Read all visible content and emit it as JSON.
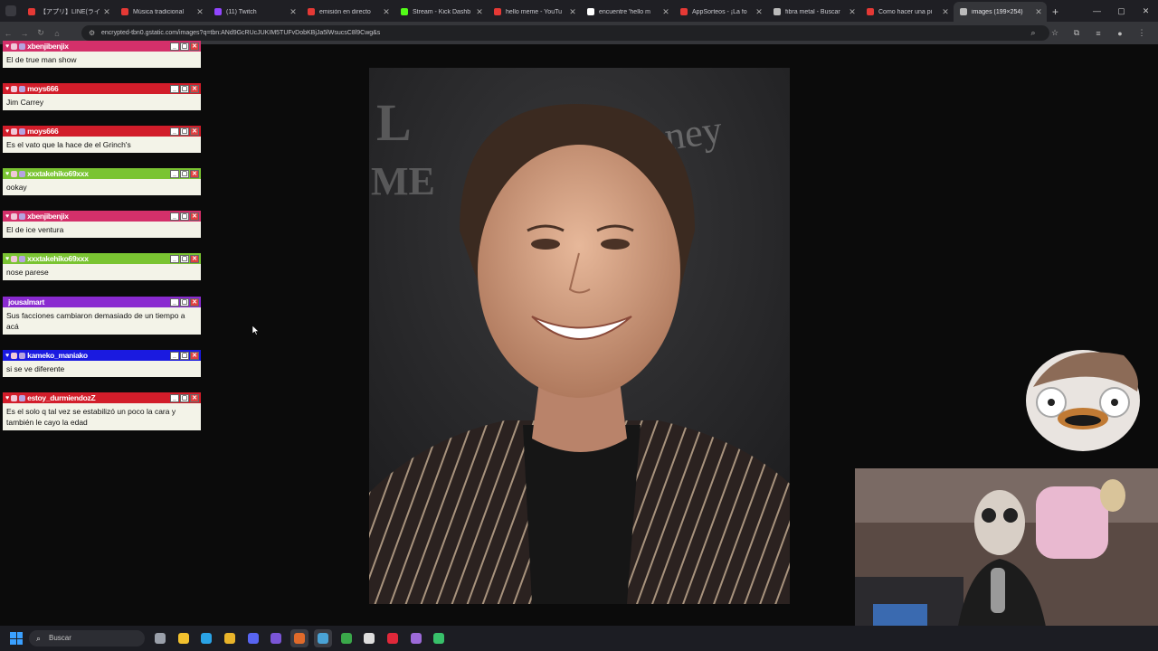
{
  "browser": {
    "tabs": [
      {
        "title": "【アプリ】LINE(ライ",
        "icon": "youtube-icon",
        "color": "#e53935"
      },
      {
        "title": "Música tradicional",
        "icon": "youtube-icon",
        "color": "#e53935"
      },
      {
        "title": "(11) Twitch",
        "icon": "twitch-icon",
        "color": "#9146ff"
      },
      {
        "title": "emisión en directo",
        "icon": "youtube-icon",
        "color": "#e53935"
      },
      {
        "title": "Stream - Kick Dashb",
        "icon": "kick-icon",
        "color": "#53fc18"
      },
      {
        "title": "hello meme - YouTu",
        "icon": "youtube-icon",
        "color": "#e53935"
      },
      {
        "title": "encuentre 'hello m",
        "icon": "tiktok-icon",
        "color": "#ffffff"
      },
      {
        "title": "AppSorteos - ¡La fo",
        "icon": "youtube-icon",
        "color": "#e53935"
      },
      {
        "title": "fibra metal - Buscar",
        "icon": "globe-icon",
        "color": "#bbbbbb"
      },
      {
        "title": "Como hacer una pi",
        "icon": "youtube-icon",
        "color": "#e53935"
      },
      {
        "title": "images (199×254)",
        "icon": "globe-icon",
        "color": "#bbbbbb",
        "active": true
      }
    ],
    "new_tab_glyph": "+",
    "window_controls": {
      "minimize": "—",
      "maximize": "▢",
      "close": "✕"
    },
    "url": "encrypted-tbn0.gstatic.com/images?q=tbn:ANd9GcRUcJUKIM5TUFvDobKBjJa5lWsucsC8l9Cwg&s",
    "nav": {
      "back": "←",
      "forward": "→",
      "reload": "↻",
      "home": "⌂"
    },
    "toolbar_icons": [
      "zoom-icon",
      "star-icon",
      "extensions-icon",
      "media-icon",
      "profile-icon",
      "menu-icon"
    ]
  },
  "chat": {
    "messages": [
      {
        "user": "xbenjibenjix",
        "text": "El de true man show",
        "header_color": "#d4306a",
        "badges": true
      },
      {
        "user": "moys666",
        "text": "Jim Carrey",
        "header_color": "#d21d2a",
        "badges": true
      },
      {
        "user": "moys666",
        "text": "Es el vato que la hace de el Grinch's",
        "header_color": "#d21d2a",
        "badges": true
      },
      {
        "user": "xxxtakehiko69xxx",
        "text": "ookay",
        "header_color": "#7ac432",
        "badges": true
      },
      {
        "user": "xbenjibenjix",
        "text": "El de ice ventura",
        "header_color": "#d4306a",
        "badges": true
      },
      {
        "user": "xxxtakehiko69xxx",
        "text": "nose parese",
        "header_color": "#7ac432",
        "badges": true
      },
      {
        "user": "jousalmart",
        "text": "Sus facciones cambiaron demasiado de un tiempo a acá",
        "header_color": "#8a2ad0",
        "badges": false
      },
      {
        "user": "kameko_maniako",
        "text": "si se ve diferente",
        "header_color": "#1a1ae0",
        "badges": true
      },
      {
        "user": "estoy_durmiendozZ",
        "text": "Es el solo q tal vez se estabilizó un poco la cara y también le cayo la edad",
        "header_color": "#d21d2a",
        "badges": true
      }
    ],
    "window_buttons": {
      "minimize": "_",
      "maximize": "▢",
      "close": "✕"
    }
  },
  "taskbar": {
    "search_placeholder": "Buscar",
    "apps": [
      {
        "icon": "task-view-icon",
        "color": "#9aa0aa"
      },
      {
        "icon": "file-explorer-icon",
        "color": "#f2c12e"
      },
      {
        "icon": "edge-icon",
        "color": "#2aa3e6"
      },
      {
        "icon": "chrome-icon",
        "color": "#e9b42a"
      },
      {
        "icon": "discord-icon",
        "color": "#5865f2"
      },
      {
        "icon": "vtuber-app-icon",
        "color": "#7a55d6"
      },
      {
        "icon": "streamlabs-icon",
        "color": "#e06a2a",
        "active": true
      },
      {
        "icon": "vtube-studio-icon",
        "color": "#4aa3d6",
        "active": true
      },
      {
        "icon": "green-app-icon",
        "color": "#3aa84a"
      },
      {
        "icon": "obs-icon",
        "color": "#dddddd"
      },
      {
        "icon": "opera-icon",
        "color": "#e0283a"
      },
      {
        "icon": "purple-app-icon",
        "color": "#9c6ad8"
      },
      {
        "icon": "game-app-icon",
        "color": "#38c06a"
      }
    ]
  }
}
